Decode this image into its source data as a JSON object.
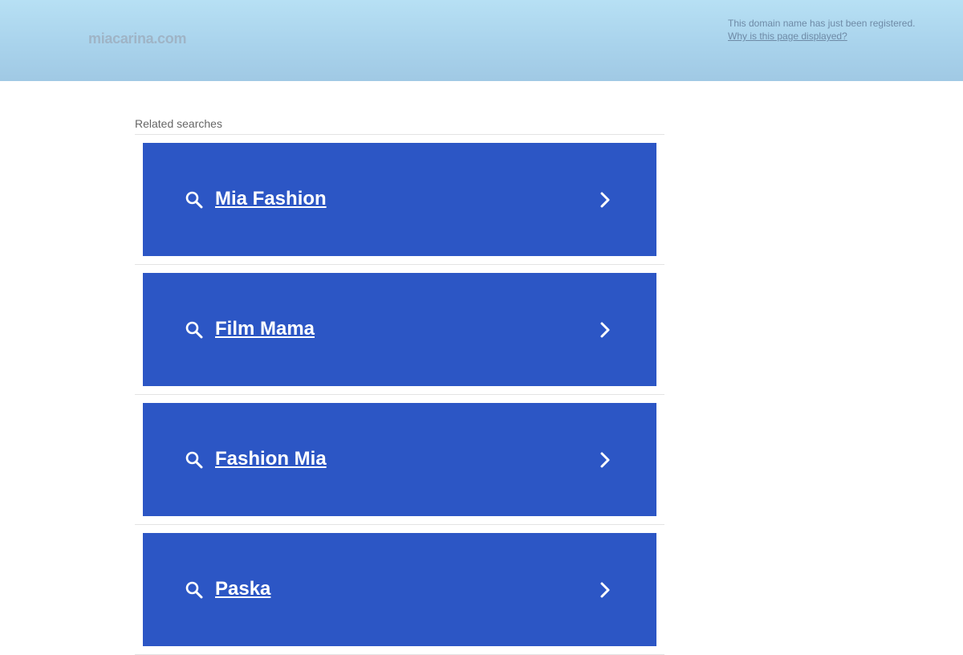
{
  "header": {
    "domain": "miacarina.com",
    "notice_text": "This domain name has just been registered.",
    "notice_link": "Why is this page displayed?"
  },
  "related": {
    "heading": "Related searches",
    "items": [
      {
        "label": "Mia Fashion",
        "icon": "search-icon",
        "arrow": "chevron-right-icon"
      },
      {
        "label": "Film Mama",
        "icon": "search-icon",
        "arrow": "chevron-right-icon"
      },
      {
        "label": "Fashion Mia",
        "icon": "search-icon",
        "arrow": "chevron-right-icon"
      },
      {
        "label": "Paska",
        "icon": "search-icon",
        "arrow": "chevron-right-icon"
      }
    ]
  },
  "colors": {
    "result_background": "#2c56c5",
    "header_gradient_top": "#b7e0f4",
    "header_gradient_bottom": "#a0c9e4"
  }
}
